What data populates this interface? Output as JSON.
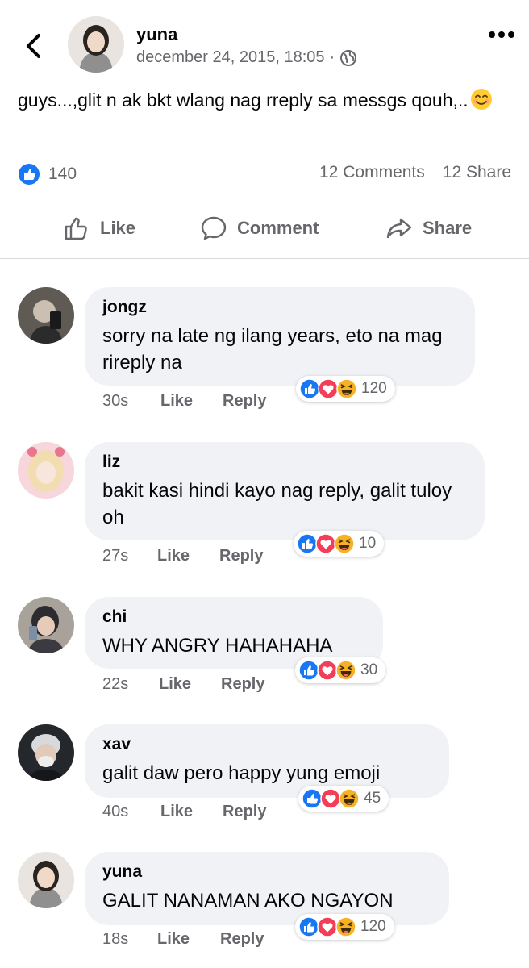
{
  "post": {
    "author": "yuna",
    "date": "december 24, 2015, 18:05",
    "separator": "·",
    "text": "guys...,glit n ak bkt wlang nag rreply sa messgs qouh,..",
    "like_count": "140",
    "comments_count": "12 Comments",
    "share_count": "12 Share"
  },
  "actions": {
    "like": "Like",
    "comment": "Comment",
    "share": "Share"
  },
  "icons": {
    "back": "chevron-left-icon",
    "more": "more-dots-icon",
    "audience": "globe-icon",
    "like_reaction": "thumbs-up-reaction-icon",
    "love_reaction": "heart-reaction-icon",
    "haha_reaction": "laughing-reaction-icon"
  },
  "colors": {
    "like_blue": "#1877f2",
    "love_red": "#f33e58",
    "haha_yellow": "#f7b125",
    "bubble_bg": "#f0f2f5",
    "meta_gray": "#65676b"
  },
  "comments": [
    {
      "name": "jongz",
      "text": "sorry na late ng ilang years, eto na mag rireply na",
      "time": "30s",
      "like": "Like",
      "reply": "Reply",
      "reactions": "120"
    },
    {
      "name": "liz",
      "text": "bakit kasi hindi kayo nag reply, galit tuloy oh",
      "time": "27s",
      "like": "Like",
      "reply": "Reply",
      "reactions": "10"
    },
    {
      "name": "chi",
      "text": "WHY ANGRY HAHAHAHA",
      "time": "22s",
      "like": "Like",
      "reply": "Reply",
      "reactions": "30"
    },
    {
      "name": "xav",
      "text": "galit daw pero happy yung emoji",
      "time": "40s",
      "like": "Like",
      "reply": "Reply",
      "reactions": "45"
    },
    {
      "name": "yuna",
      "text": "GALIT NANAMAN AKO NGAYON",
      "time": "18s",
      "like": "Like",
      "reply": "Reply",
      "reactions": "120"
    }
  ]
}
